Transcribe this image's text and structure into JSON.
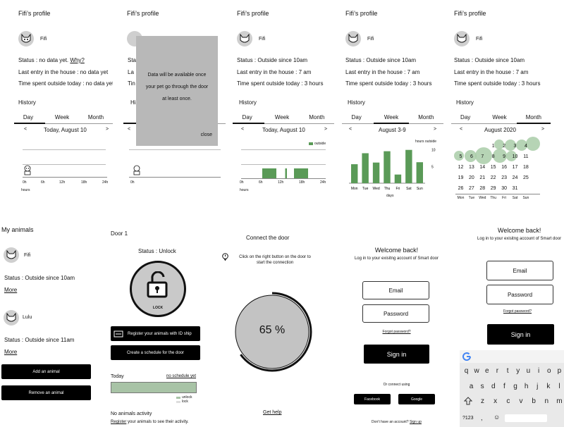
{
  "profile": {
    "title": "Fifi’s profile",
    "pet_name": "Fifi",
    "status_none": "Status : no data yet.",
    "why": "Why?",
    "last_entry_none": "Last entry in the house : no data yet",
    "time_outside_none": "Time spent outside today : no data yet",
    "status": "Status : Outside since 10am",
    "last_entry": "Last entry in the house : 7 am",
    "time_outside": "Time spent outside today : 3 hours",
    "history": "History",
    "tabs": [
      "Day",
      "Week",
      "Month"
    ],
    "nav_prev": "<",
    "nav_next": ">",
    "day_label": "Today, August 10",
    "week_label": "August 3-9",
    "month_label": "August 2020",
    "hours_axis": [
      "0h",
      "6h",
      "12h",
      "18h",
      "24h"
    ],
    "hours_label": "hours",
    "legend_outside": "outside",
    "hours_outside_label": "hours outside",
    "days_label": "days"
  },
  "modal": {
    "text_line1": "Data will be available once",
    "text_line2": "your pet go through the door",
    "text_line3": "at least once.",
    "close": "close"
  },
  "chart_data": [
    {
      "type": "bar",
      "title": "Today, August 10",
      "xlabel": "hours",
      "x_ticks": [
        "0h",
        "6h",
        "12h",
        "18h",
        "24h"
      ],
      "series": [
        {
          "name": "outside",
          "intervals_hours": [
            [
              6,
              10
            ],
            [
              12.5,
              13
            ],
            [
              15,
              19
            ]
          ]
        }
      ],
      "xlim": [
        0,
        24
      ]
    },
    {
      "type": "bar",
      "title": "August 3-9",
      "categories": [
        "Mon",
        "Tue",
        "Wed",
        "Thu",
        "Fri",
        "Sat",
        "Sun"
      ],
      "values": [
        5.7,
        9.0,
        6.2,
        9.6,
        2.6,
        10.0,
        6.3
      ],
      "ylabel": "hours outside",
      "xlabel": "days",
      "y_ticks": [
        5,
        10
      ],
      "ylim": [
        0,
        11
      ]
    }
  ],
  "calendar": {
    "weekdays": [
      "Mon",
      "Tue",
      "Wed",
      "Thu",
      "Fri",
      "Sat",
      "Sun"
    ],
    "rows": [
      [
        "",
        "",
        "",
        "",
        "",
        "1",
        "2"
      ],
      [
        "",
        "",
        "",
        "",
        "",
        "",
        ""
      ],
      [
        "3",
        "4",
        "5",
        "6",
        "7",
        "8",
        "9"
      ]
    ],
    "grid": [
      [
        "",
        "",
        "",
        "1",
        "2",
        "3",
        "4"
      ],
      [
        "5",
        "6",
        "7",
        "8",
        "9",
        "10",
        "11"
      ],
      [
        "12",
        "13",
        "14",
        "15",
        "16",
        "17",
        "18"
      ],
      [
        "19",
        "20",
        "21",
        "22",
        "23",
        "24",
        "25"
      ],
      [
        "26",
        "27",
        "28",
        "29",
        "30",
        "31",
        ""
      ]
    ]
  },
  "animals": {
    "title": "My animals",
    "items": [
      {
        "name": "Fifi",
        "status": "Status : Outside since 10am",
        "more": "More"
      },
      {
        "name": "Lulu",
        "status": "Status : Outside since 11am",
        "more": "More"
      }
    ],
    "add": "Add an animal",
    "remove": "Remove an animal"
  },
  "door": {
    "title": "Door 1",
    "status": "Status : Unlock",
    "lock_label": "LOCK",
    "register_btn": "Register your animals with ID ship",
    "schedule_btn": "Create a schedule for the door",
    "today": "Today",
    "no_schedule": "no schedule yet",
    "legend_unlock": "unlock",
    "legend_lock": "lock",
    "no_activity": "No animals activity",
    "register_link": "Register",
    "register_rest": " your animals to see their activity."
  },
  "connect": {
    "title": "Connect the door",
    "instruction_line1": "Click on the right button on the door to",
    "instruction_line2": "start the connection",
    "progress_text": "65 %",
    "progress": 0.65,
    "help": "Get help"
  },
  "login": {
    "welcome": "Welcome back!",
    "subtitle": "Log in to your exisitng account of Smart door",
    "subtitle2": "Log in to your exisitng account of Smart door",
    "email": "Email",
    "password": "Password",
    "forgot": "Forgot password?",
    "signin": "Sign in",
    "or_connect": "Or connect using",
    "facebook": "Facebook",
    "google": "Google",
    "no_account": "Don’t  have an account?",
    "signup": "Sign up"
  },
  "keyboard": {
    "row1": [
      "q",
      "w",
      "e",
      "r",
      "t",
      "y",
      "u",
      "i",
      "o",
      "p"
    ],
    "row2": [
      "a",
      "s",
      "d",
      "f",
      "g",
      "h",
      "j",
      "k",
      "l"
    ],
    "row3": [
      "z",
      "x",
      "c",
      "v",
      "b",
      "n",
      "m"
    ],
    "symbols": "?123",
    "comma": ",",
    "emoji": "☺"
  }
}
